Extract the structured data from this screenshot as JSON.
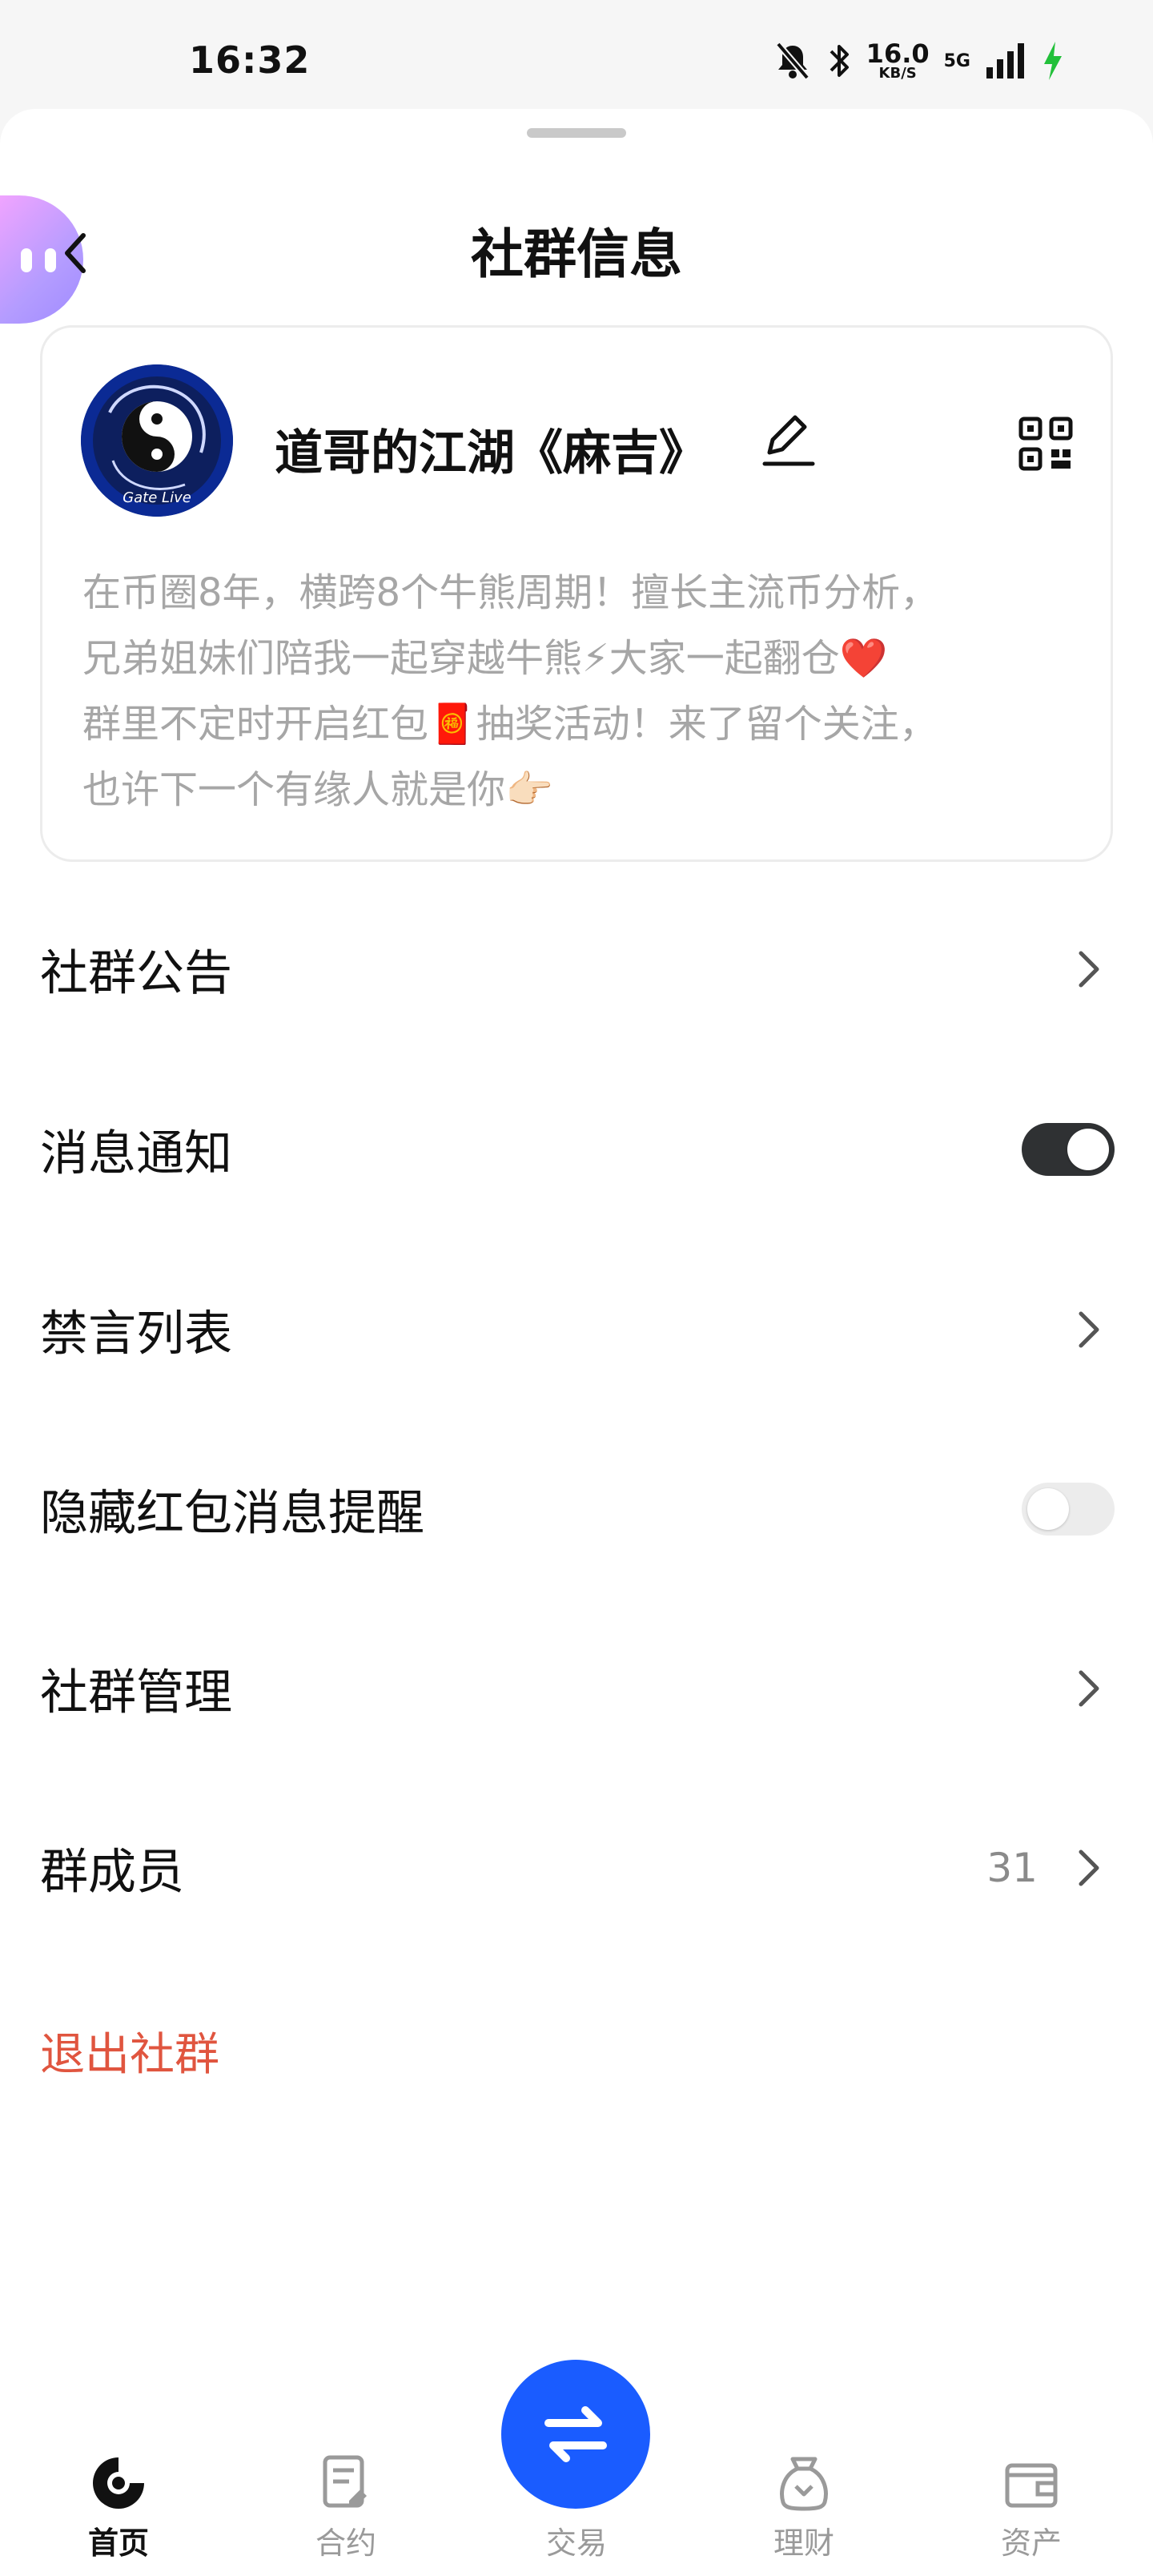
{
  "status_bar": {
    "time": "16:32",
    "speed_value": "16.0",
    "speed_unit": "KB/S",
    "network": "5G",
    "icons": [
      "mute-icon",
      "bluetooth-icon",
      "signal-icon",
      "charging-icon"
    ]
  },
  "header": {
    "title": "社群信息",
    "back_icon": "chevron-left-icon"
  },
  "group": {
    "name": "道哥的江湖《麻吉》",
    "avatar_text": "Gate Live",
    "description": [
      "在币圈8年，横跨8个牛熊周期！擅长主流币分析，",
      "兄弟姐妹们陪我一起穿越牛熊⚡大家一起翻仓❤️",
      "群里不定时开启红包🧧抽奖活动！来了留个关注，",
      "也许下一个有缘人就是你👉🏻"
    ]
  },
  "settings": {
    "announcement": "社群公告",
    "notifications": "消息通知",
    "notifications_on": true,
    "mute_list": "禁言列表",
    "hide_redpacket": "隐藏红包消息提醒",
    "hide_redpacket_on": false,
    "manage": "社群管理",
    "members": "群成员",
    "members_count": "31",
    "exit": "退出社群"
  },
  "bottom_nav": {
    "items": [
      "首页",
      "合约",
      "交易",
      "理财",
      "资产"
    ],
    "active": "首页"
  },
  "colors": {
    "accent": "#1a5cff",
    "danger": "#e0553f",
    "toggle_on": "#2f3133"
  }
}
